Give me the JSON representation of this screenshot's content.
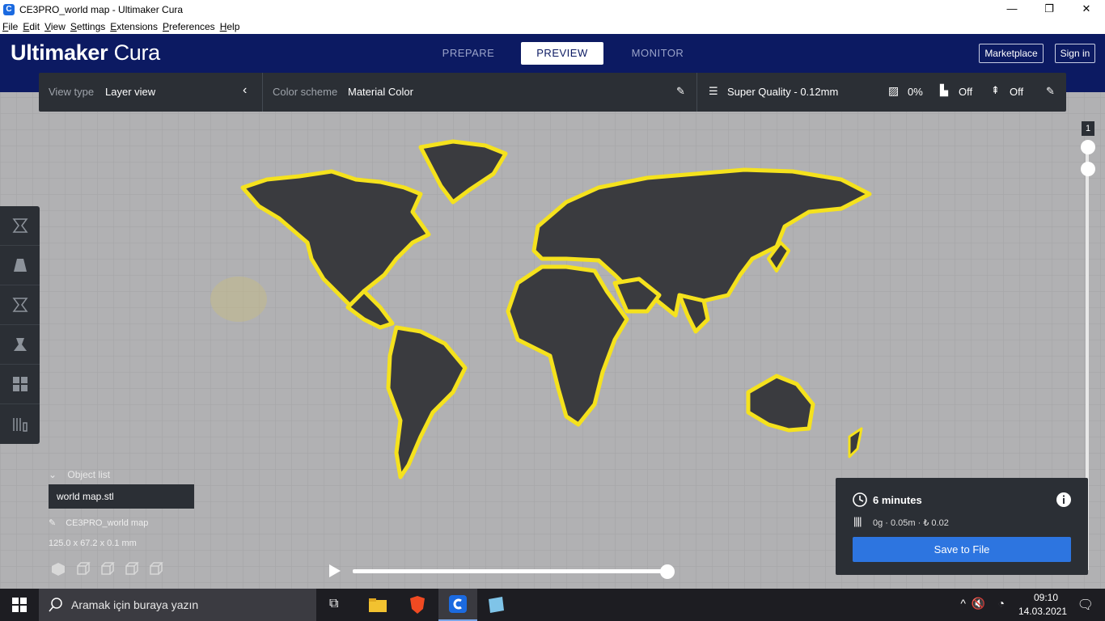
{
  "window": {
    "title": "CE3PRO_world map - Ultimaker Cura",
    "app_icon": "C",
    "minimize": "—",
    "maximize": "❐",
    "close": "✕"
  },
  "menu": [
    "File",
    "Edit",
    "View",
    "Settings",
    "Extensions",
    "Preferences",
    "Help"
  ],
  "header": {
    "logo_bold": "Ultimaker",
    "logo_light": "Cura",
    "stages": [
      "PREPARE",
      "PREVIEW",
      "MONITOR"
    ],
    "active_stage": "PREVIEW",
    "marketplace": "Marketplace",
    "signin": "Sign in"
  },
  "toolbar": {
    "view_type_label": "View type",
    "view_type_value": "Layer view",
    "color_scheme_label": "Color scheme",
    "color_scheme_value": "Material Color",
    "profile": "Super Quality - 0.12mm",
    "infill": "0%",
    "support": "Off",
    "adhesion": "Off"
  },
  "left_tools": [
    "move-tool",
    "scale-tool",
    "rotate-tool",
    "mirror-tool",
    "per-model-settings-tool",
    "support-blocker-tool"
  ],
  "object": {
    "list_label": "Object list",
    "selected": "world map.stl",
    "job_name": "CE3PRO_world map",
    "dimensions": "125.0 x 67.2 x 0.1 mm"
  },
  "layer_slider": {
    "current_layer": "1",
    "progress": 1.0
  },
  "print_info": {
    "time": "6 minutes",
    "material": "0g · 0.05m · ₺ 0.02",
    "save_button": "Save to File"
  },
  "colors": {
    "header_bg": "#0c1a62",
    "panel_bg": "#2b2f35",
    "accent": "#2d75e0",
    "path_yellow": "#f5e21d",
    "viewport_bg": "#b1b1b3"
  },
  "taskbar": {
    "search_placeholder": "Aramak için buraya yazın",
    "time": "09:10",
    "date": "14.03.2021"
  }
}
